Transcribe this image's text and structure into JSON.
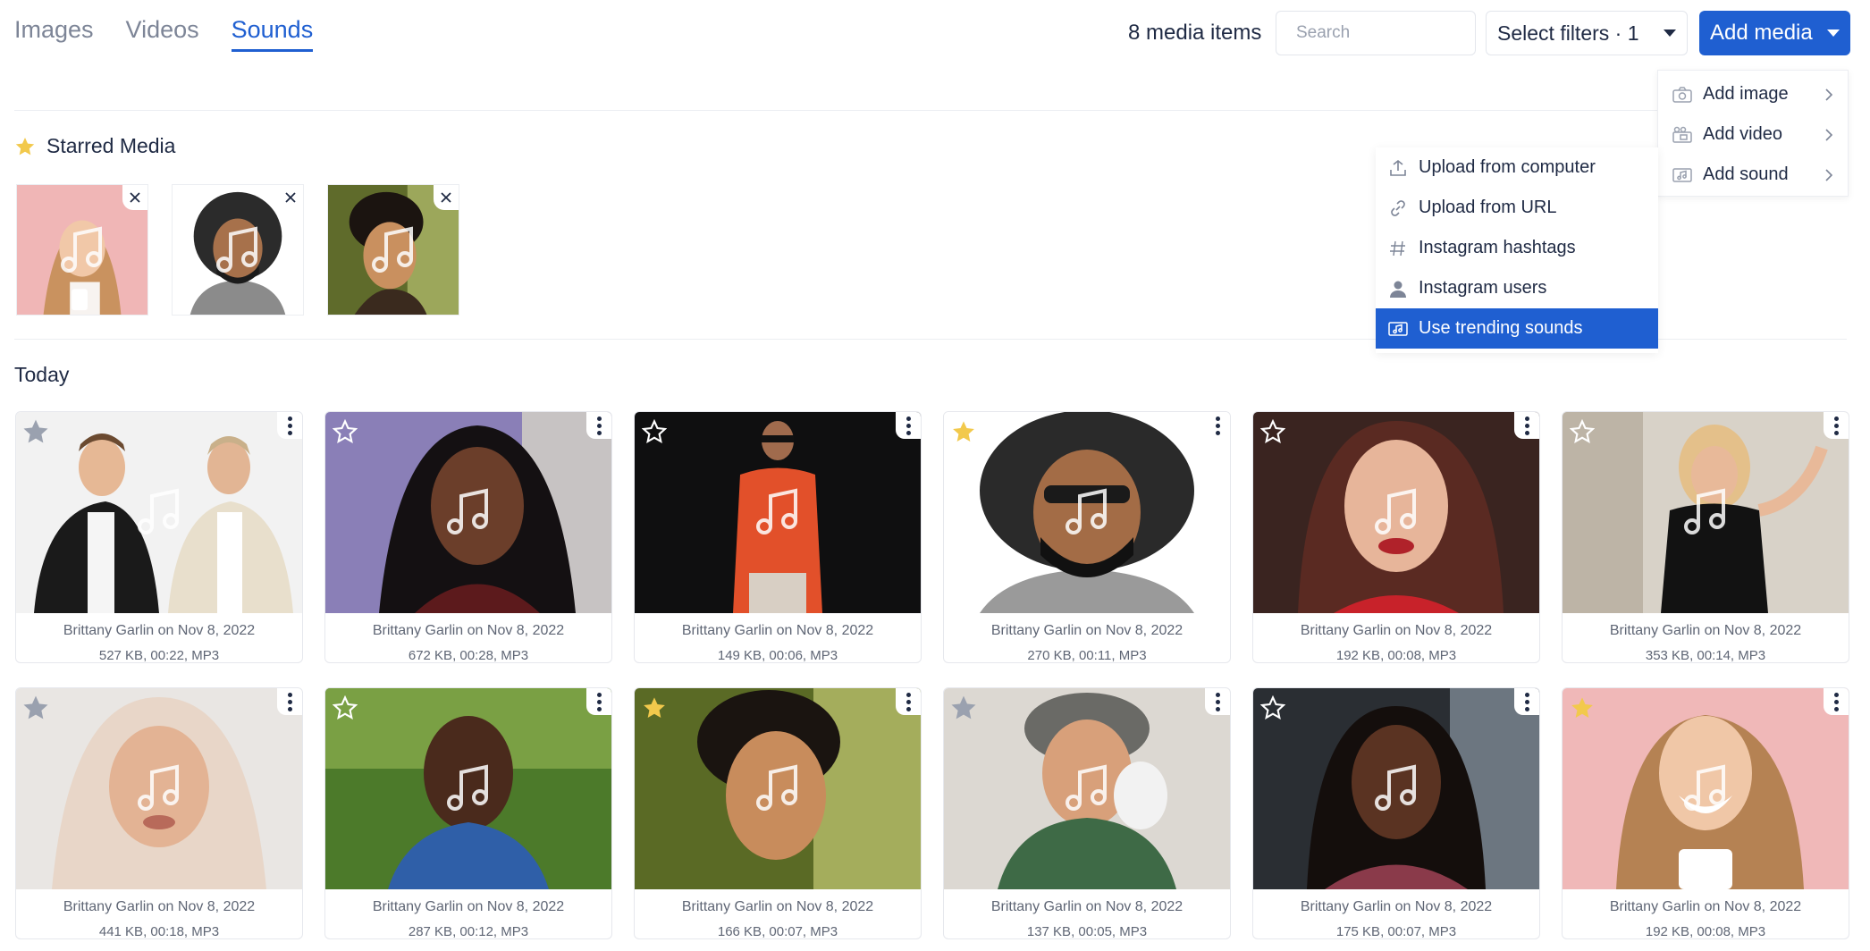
{
  "tabs": [
    {
      "label": "Images",
      "active": false
    },
    {
      "label": "Videos",
      "active": false
    },
    {
      "label": "Sounds",
      "active": true
    }
  ],
  "toolbar": {
    "count_label": "8 media items",
    "search_placeholder": "Search",
    "filters_label": "Select filters · 1",
    "add_media_label": "Add media"
  },
  "add_menu": {
    "items": [
      {
        "label": "Add image",
        "icon": "camera-icon"
      },
      {
        "label": "Add video",
        "icon": "video-icon"
      },
      {
        "label": "Add sound",
        "icon": "sound-icon"
      }
    ]
  },
  "sound_submenu": {
    "items": [
      {
        "label": "Upload from computer",
        "icon": "upload-icon"
      },
      {
        "label": "Upload from URL",
        "icon": "link-icon"
      },
      {
        "label": "Instagram hashtags",
        "icon": "hashtag-icon"
      },
      {
        "label": "Instagram users",
        "icon": "user-icon"
      },
      {
        "label": "Use trending sounds",
        "icon": "trending-icon",
        "active": true
      }
    ]
  },
  "starred": {
    "title": "Starred Media",
    "items": [
      {
        "desc": "woman-pink-bg"
      },
      {
        "desc": "cartoon-man"
      },
      {
        "desc": "young-man-outdoor"
      }
    ]
  },
  "section_title": "Today",
  "cards": [
    {
      "author": "Brittany Garlin on Nov 8, 2022",
      "meta": "527 KB, 00:22, MP3",
      "starred": false
    },
    {
      "author": "Brittany Garlin on Nov 8, 2022",
      "meta": "672 KB, 00:28, MP3",
      "starred": false
    },
    {
      "author": "Brittany Garlin on Nov 8, 2022",
      "meta": "149 KB, 00:06, MP3",
      "starred": false
    },
    {
      "author": "Brittany Garlin on Nov 8, 2022",
      "meta": "270 KB, 00:11, MP3",
      "starred": true
    },
    {
      "author": "Brittany Garlin on Nov 8, 2022",
      "meta": "192 KB, 00:08, MP3",
      "starred": false
    },
    {
      "author": "Brittany Garlin on Nov 8, 2022",
      "meta": "353 KB, 00:14, MP3",
      "starred": false
    },
    {
      "author": "Brittany Garlin on Nov 8, 2022",
      "meta": "441 KB, 00:18, MP3",
      "starred": false
    },
    {
      "author": "Brittany Garlin on Nov 8, 2022",
      "meta": "287 KB, 00:12, MP3",
      "starred": false
    },
    {
      "author": "Brittany Garlin on Nov 8, 2022",
      "meta": "166 KB, 00:07, MP3",
      "starred": true
    },
    {
      "author": "Brittany Garlin on Nov 8, 2022",
      "meta": "137 KB, 00:05, MP3",
      "starred": false
    },
    {
      "author": "Brittany Garlin on Nov 8, 2022",
      "meta": "175 KB, 00:07, MP3",
      "starred": false
    },
    {
      "author": "Brittany Garlin on Nov 8, 2022",
      "meta": "192 KB, 00:08, MP3",
      "starred": true
    }
  ],
  "colors": {
    "accent": "#1f5fd1",
    "star_filled": "#f2c94c",
    "text": "#1f2a44",
    "muted": "#5f6675"
  }
}
